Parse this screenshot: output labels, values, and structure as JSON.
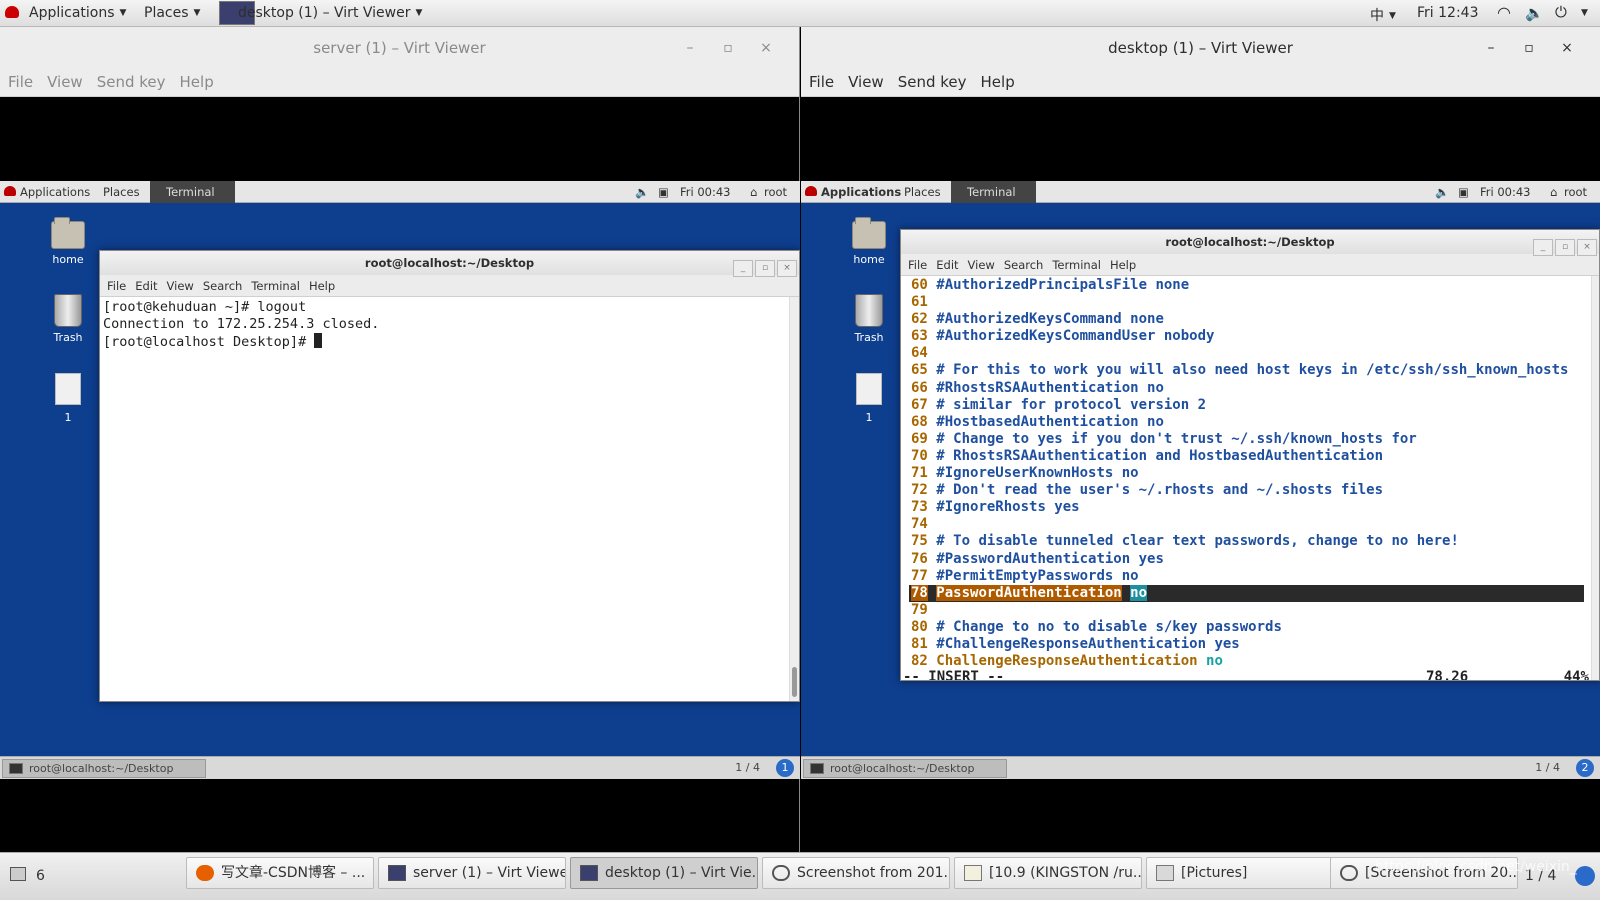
{
  "host_topbar": {
    "applications": "Applications",
    "places": "Places",
    "active_window": "desktop (1) – Virt Viewer",
    "input_method": "中",
    "clock": "Fri 12:43"
  },
  "left_viewer": {
    "title": "server (1) – Virt Viewer",
    "controls": [
      "–",
      "▫",
      "×"
    ],
    "menu": [
      "File",
      "View",
      "Send key",
      "Help"
    ],
    "guest": {
      "topbar": {
        "applications": "Applications",
        "places": "Places",
        "terminal": "Terminal",
        "clock": "Fri 00:43",
        "user": "root"
      },
      "icons": [
        "home",
        "Trash",
        "1"
      ],
      "terminal": {
        "title": "root@localhost:~/Desktop",
        "menu": [
          "File",
          "Edit",
          "View",
          "Search",
          "Terminal",
          "Help"
        ],
        "lines": [
          "[root@kehuduan ~]# logout",
          "Connection to 172.25.254.3 closed.",
          "[root@localhost Desktop]# "
        ]
      },
      "taskbar": {
        "task": "root@localhost:~/Desktop",
        "workspace": "1 / 4",
        "info": "1"
      }
    }
  },
  "right_viewer": {
    "title": "desktop (1) – Virt Viewer",
    "controls": [
      "–",
      "▫",
      "×"
    ],
    "menu": [
      "File",
      "View",
      "Send key",
      "Help"
    ],
    "guest": {
      "topbar": {
        "applications": "Applications",
        "places": "Places",
        "terminal": "Terminal",
        "clock": "Fri 00:43",
        "user": "root"
      },
      "icons": [
        "home",
        "Trash",
        "1"
      ],
      "terminal": {
        "title": "root@localhost:~/Desktop",
        "menu": [
          "File",
          "Edit",
          "View",
          "Search",
          "Terminal",
          "Help"
        ],
        "vim_lines": [
          {
            "n": "60",
            "t": "#AuthorizedPrincipalsFile none",
            "k": "c"
          },
          {
            "n": "61",
            "t": "",
            "k": "c"
          },
          {
            "n": "62",
            "t": "#AuthorizedKeysCommand none",
            "k": "c"
          },
          {
            "n": "63",
            "t": "#AuthorizedKeysCommandUser nobody",
            "k": "c"
          },
          {
            "n": "64",
            "t": "",
            "k": "c"
          },
          {
            "n": "65",
            "t": "# For this to work you will also need host keys in /etc/ssh/ssh_known_hosts",
            "k": "c"
          },
          {
            "n": "66",
            "t": "#RhostsRSAAuthentication no",
            "k": "c"
          },
          {
            "n": "67",
            "t": "# similar for protocol version 2",
            "k": "c"
          },
          {
            "n": "68",
            "t": "#HostbasedAuthentication no",
            "k": "c"
          },
          {
            "n": "69",
            "t": "# Change to yes if you don't trust ~/.ssh/known_hosts for",
            "k": "c"
          },
          {
            "n": "70",
            "t": "# RhostsRSAAuthentication and HostbasedAuthentication",
            "k": "c"
          },
          {
            "n": "71",
            "t": "#IgnoreUserKnownHosts no",
            "k": "c"
          },
          {
            "n": "72",
            "t": "# Don't read the user's ~/.rhosts and ~/.shosts files",
            "k": "c"
          },
          {
            "n": "73",
            "t": "#IgnoreRhosts yes",
            "k": "c"
          },
          {
            "n": "74",
            "t": "",
            "k": "c"
          },
          {
            "n": "75",
            "t": "# To disable tunneled clear text passwords, change to no here!",
            "k": "c"
          },
          {
            "n": "76",
            "t": "#PasswordAuthentication yes",
            "k": "c"
          },
          {
            "n": "77",
            "t": "#PermitEmptyPasswords no",
            "k": "c"
          },
          {
            "n": "78",
            "t": "PasswordAuthentication",
            "v": "no",
            "k": "hl"
          },
          {
            "n": "79",
            "t": "",
            "k": "c"
          },
          {
            "n": "80",
            "t": "# Change to no to disable s/key passwords",
            "k": "c"
          },
          {
            "n": "81",
            "t": "#ChallengeResponseAuthentication yes",
            "k": "c"
          },
          {
            "n": "82",
            "t": "ChallengeResponseAuthentication",
            "v": "no",
            "k": "kv"
          }
        ],
        "status_mode": "-- INSERT --",
        "status_pos": "78,26",
        "status_pct": "44%"
      },
      "taskbar": {
        "task": "root@localhost:~/Desktop",
        "workspace": "1 / 4",
        "info": "2"
      }
    }
  },
  "host_taskbar": {
    "show_desktop_count": "6",
    "buttons": [
      {
        "label": "写文章-CSDN博客 – ...",
        "icon": "firefox-icon"
      },
      {
        "label": "server (1) – Virt Viewer",
        "icon": "monitor-icon"
      },
      {
        "label": "desktop (1) – Virt Vie...",
        "icon": "monitor-icon"
      },
      {
        "label": "Screenshot from 201...",
        "icon": "magnifier-icon"
      },
      {
        "label": "[10.9 (KINGSTON /ru...",
        "icon": "editor-icon"
      },
      {
        "label": "[Pictures]",
        "icon": "folder-icon"
      },
      {
        "label": "[Screenshot from 20...",
        "icon": "magnifier-icon"
      }
    ],
    "workspace": "1 / 4",
    "watermark": "https://blog.csdn.net/weixin_"
  }
}
